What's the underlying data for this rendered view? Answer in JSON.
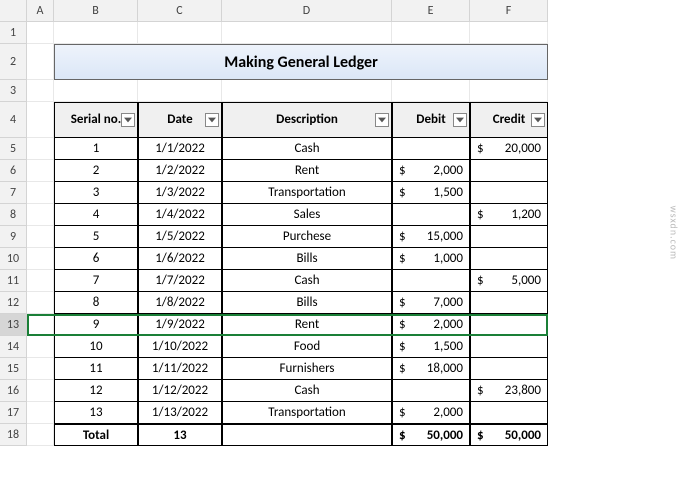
{
  "columns": [
    "A",
    "B",
    "C",
    "D",
    "E",
    "F"
  ],
  "rows": [
    "1",
    "2",
    "3",
    "4",
    "5",
    "6",
    "7",
    "8",
    "9",
    "10",
    "11",
    "12",
    "13",
    "14",
    "15",
    "16",
    "17",
    "18"
  ],
  "selected_row": "13",
  "title": "Making General Ledger",
  "headers": {
    "serial": "Serial no.",
    "date": "Date",
    "description": "Description",
    "debit": "Debit",
    "credit": "Credit"
  },
  "chart_data": {
    "type": "table",
    "columns": [
      "Serial no.",
      "Date",
      "Description",
      "Debit",
      "Credit"
    ],
    "rows": [
      {
        "serial": "1",
        "date": "1/1/2022",
        "description": "Cash",
        "debit": "",
        "credit": "20,000"
      },
      {
        "serial": "2",
        "date": "1/2/2022",
        "description": "Rent",
        "debit": "2,000",
        "credit": ""
      },
      {
        "serial": "3",
        "date": "1/3/2022",
        "description": "Transportation",
        "debit": "1,500",
        "credit": ""
      },
      {
        "serial": "4",
        "date": "1/4/2022",
        "description": "Sales",
        "debit": "",
        "credit": "1,200"
      },
      {
        "serial": "5",
        "date": "1/5/2022",
        "description": "Purchese",
        "debit": "15,000",
        "credit": ""
      },
      {
        "serial": "6",
        "date": "1/6/2022",
        "description": "Bills",
        "debit": "1,000",
        "credit": ""
      },
      {
        "serial": "7",
        "date": "1/7/2022",
        "description": "Cash",
        "debit": "",
        "credit": "5,000"
      },
      {
        "serial": "8",
        "date": "1/8/2022",
        "description": "Bills",
        "debit": "7,000",
        "credit": ""
      },
      {
        "serial": "9",
        "date": "1/9/2022",
        "description": "Rent",
        "debit": "2,000",
        "credit": ""
      },
      {
        "serial": "10",
        "date": "1/10/2022",
        "description": "Food",
        "debit": "1,500",
        "credit": ""
      },
      {
        "serial": "11",
        "date": "1/11/2022",
        "description": "Furnishers",
        "debit": "18,000",
        "credit": ""
      },
      {
        "serial": "12",
        "date": "1/12/2022",
        "description": "Cash",
        "debit": "",
        "credit": "23,800"
      },
      {
        "serial": "13",
        "date": "1/13/2022",
        "description": "Transportation",
        "debit": "2,000",
        "credit": ""
      }
    ],
    "total": {
      "label": "Total",
      "count": "13",
      "debit": "50,000",
      "credit": "50,000"
    }
  },
  "currency": "$",
  "watermark": "wsxdn.com"
}
